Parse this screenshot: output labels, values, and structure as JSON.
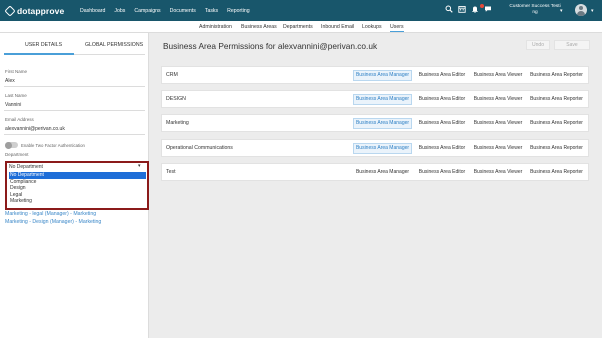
{
  "app": {
    "logo_text": "dotapprove",
    "nav": [
      "Dashboard",
      "Jobs",
      "Campaigns",
      "Documents",
      "Tasks",
      "Reporting"
    ],
    "user_line1": "Customer Success Testi",
    "user_line2": "ng",
    "colors": {
      "topbar": "#18566b",
      "accent": "#4a9fd8",
      "highlight": "#8b1a1a"
    }
  },
  "subnav": {
    "items": [
      "Administration",
      "Business Areas",
      "Departments",
      "Inbound Email",
      "Lookups",
      "Users"
    ],
    "active": "Users"
  },
  "left": {
    "tabs": [
      "USER DETAILS",
      "GLOBAL PERMISSIONS"
    ],
    "first_name_label": "First Name",
    "first_name": "Alex",
    "last_name_label": "Last Name",
    "last_name": "Vannini",
    "email_label": "Email Address",
    "email": "alexvannini@perivan.co.uk",
    "two_factor_label": "Enable Two Factor Authentication",
    "department_label": "Department",
    "department_selected": "No Department",
    "department_options": [
      "No Department",
      "Compliance",
      "Design",
      "Legal",
      "Marketing"
    ],
    "assignments": [
      "Marketing - legal (Manager) - Marketing",
      "Marketing - Design (Manager) - Marketing"
    ]
  },
  "main": {
    "title": "Business Area Permissions for alexvannini@perivan.co.uk",
    "undo_label": "Undo",
    "save_label": "Save",
    "role_labels": [
      "Business Area Manager",
      "Business Area Editor",
      "Business Area Viewer",
      "Business Area Reporter"
    ],
    "areas": [
      {
        "name": "CRM",
        "active_role": "Business Area Manager"
      },
      {
        "name": "DESIGN",
        "active_role": "Business Area Manager"
      },
      {
        "name": "Marketing",
        "active_role": "Business Area Manager"
      },
      {
        "name": "Operational Communications",
        "active_role": "Business Area Manager"
      },
      {
        "name": "Test",
        "active_role": ""
      }
    ]
  }
}
